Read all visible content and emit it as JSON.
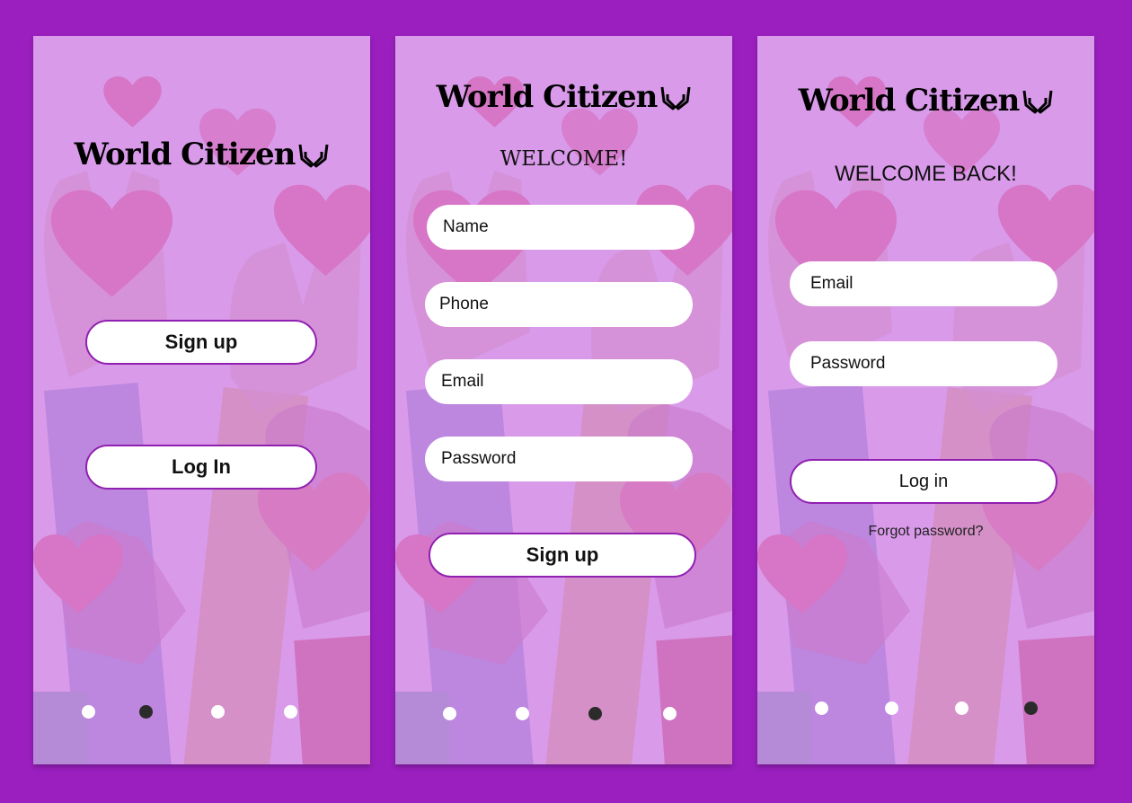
{
  "brand": {
    "name": "World Citizen"
  },
  "screen1": {
    "signup_label": "Sign up",
    "login_label": "Log In",
    "active_dot": 1
  },
  "screen2": {
    "heading": "WELCOME!",
    "name_placeholder": "Name",
    "phone_placeholder": "Phone",
    "email_placeholder": "Email",
    "password_placeholder": "Password",
    "signup_label": "Sign up",
    "active_dot": 2
  },
  "screen3": {
    "heading": "WELCOME BACK!",
    "email_placeholder": "Email",
    "password_placeholder": "Password",
    "login_label": "Log in",
    "forgot_label": "Forgot password?",
    "active_dot": 3
  },
  "colors": {
    "frame": "#9b1fbf",
    "screen": "#d99aea",
    "heart": "#d775c6",
    "button_border": "#9020b0",
    "dot_active": "#2b2b2b"
  }
}
